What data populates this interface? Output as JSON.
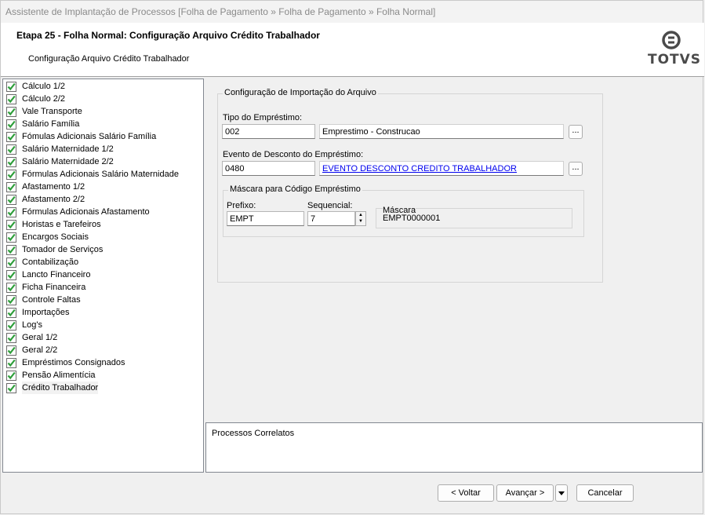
{
  "window": {
    "title": "Assistente de Implantação de Processos [Folha de Pagamento » Folha de Pagamento » Folha Normal]"
  },
  "header": {
    "step_title": "Etapa 25 - Folha Normal: Configuração Arquivo Crédito Trabalhador",
    "step_subtitle": "Configuração Arquivo Crédito Trabalhador",
    "logo_text": "TOTVS"
  },
  "sidebar": {
    "items": [
      {
        "label": "Cálculo 1/2"
      },
      {
        "label": "Cálculo 2/2"
      },
      {
        "label": "Vale Transporte"
      },
      {
        "label": "Salário Família"
      },
      {
        "label": "Fómulas Adicionais Salário Família"
      },
      {
        "label": "Salário Maternidade 1/2"
      },
      {
        "label": "Salário Maternidade 2/2"
      },
      {
        "label": "Fórmulas Adicionais Salário Maternidade"
      },
      {
        "label": "Afastamento 1/2"
      },
      {
        "label": "Afastamento 2/2"
      },
      {
        "label": "Fórmulas Adicionais Afastamento"
      },
      {
        "label": "Horistas e Tarefeiros"
      },
      {
        "label": "Encargos Sociais"
      },
      {
        "label": "Tomador de Serviços"
      },
      {
        "label": "Contabilização"
      },
      {
        "label": "Lancto Financeiro"
      },
      {
        "label": "Ficha Financeira"
      },
      {
        "label": "Controle Faltas"
      },
      {
        "label": "Importações"
      },
      {
        "label": "Log's"
      },
      {
        "label": "Geral 1/2"
      },
      {
        "label": "Geral 2/2"
      },
      {
        "label": "Empréstimos Consignados"
      },
      {
        "label": "Pensão Alimentícia"
      },
      {
        "label": "Crédito Trabalhador"
      }
    ],
    "selected_index": 24
  },
  "form": {
    "group_title": "Configuração de Importação do Arquivo",
    "tipo": {
      "label": "Tipo do Empréstimo:",
      "code": "002",
      "description": "Emprestimo - Construcao",
      "lookup_label": "..."
    },
    "evento": {
      "label": "Evento de Desconto do Empréstimo:",
      "code": "0480",
      "description": "EVENTO DESCONTO CREDITO TRABALHADOR",
      "lookup_label": "..."
    },
    "mascara_group": {
      "title": "Máscara para Código Empréstimo",
      "prefixo_label": "Prefixo:",
      "prefixo_value": "EMPT",
      "sequencial_label": "Sequencial:",
      "sequencial_value": "7",
      "mascara_label": "Máscara",
      "mascara_value": "EMPT0000001"
    }
  },
  "related": {
    "title": "Processos Correlatos"
  },
  "footer": {
    "back_label": "< Voltar",
    "next_label": "Avançar >",
    "cancel_label": "Cancelar"
  },
  "colors": {
    "check_green": "#2e9e3a",
    "link_blue": "#0000ee"
  }
}
